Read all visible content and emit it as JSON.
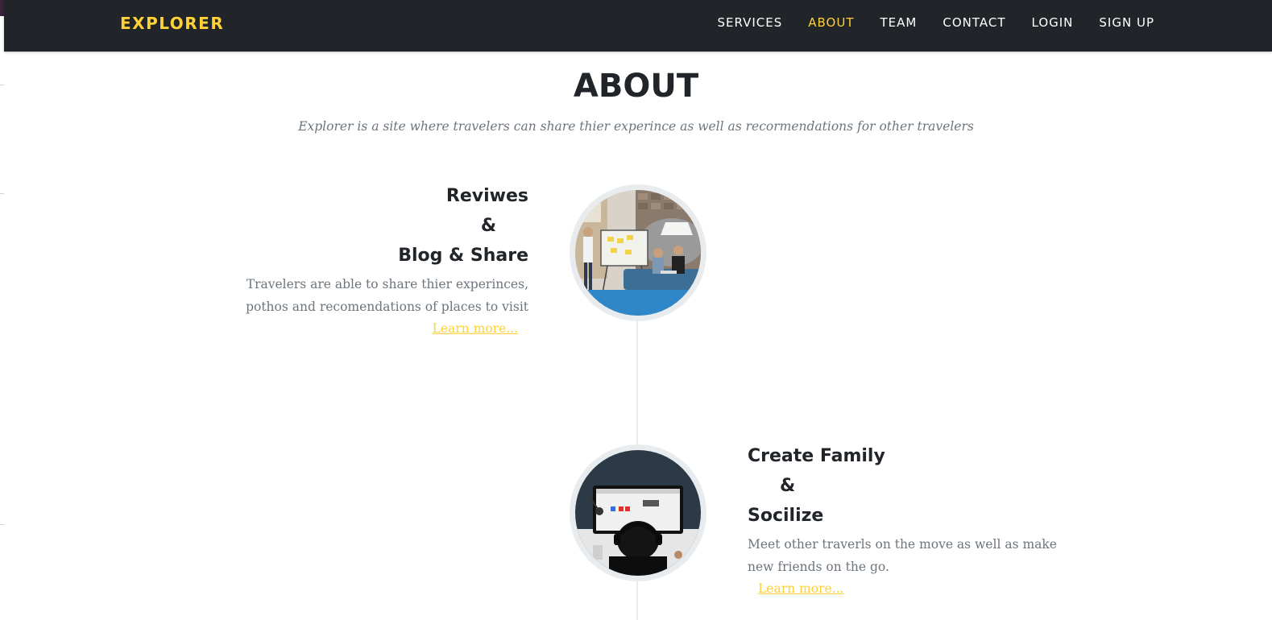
{
  "navbar": {
    "brand": "EXPLORER",
    "links": [
      {
        "label": "SERVICES",
        "active": false
      },
      {
        "label": "ABOUT",
        "active": true
      },
      {
        "label": "TEAM",
        "active": false
      },
      {
        "label": "CONTACT",
        "active": false
      },
      {
        "label": "LOGIN",
        "active": false
      },
      {
        "label": "SIGN UP",
        "active": false
      }
    ]
  },
  "about": {
    "heading": "ABOUT",
    "subheading": "Explorer is a site where travelers can share thier experince as well as recormendations for other travelers",
    "items": [
      {
        "title_line1": "Reviwes",
        "title_line2": "&",
        "title_line3": "Blog & Share",
        "body": "Travelers are able to share thier experinces, pothos and recomendations of places to visit",
        "link": "Learn more..."
      },
      {
        "title_line1": "Create Family",
        "title_line2": "&",
        "title_line3": "Socilize",
        "body": "Meet other traverls on the move as well as make new friends on the go.",
        "link": "Learn more..."
      }
    ]
  },
  "colors": {
    "navbar_bg": "#212529",
    "accent": "#fed136",
    "heading": "#212529",
    "muted": "#6c757d",
    "timeline": "#e9ecef"
  }
}
